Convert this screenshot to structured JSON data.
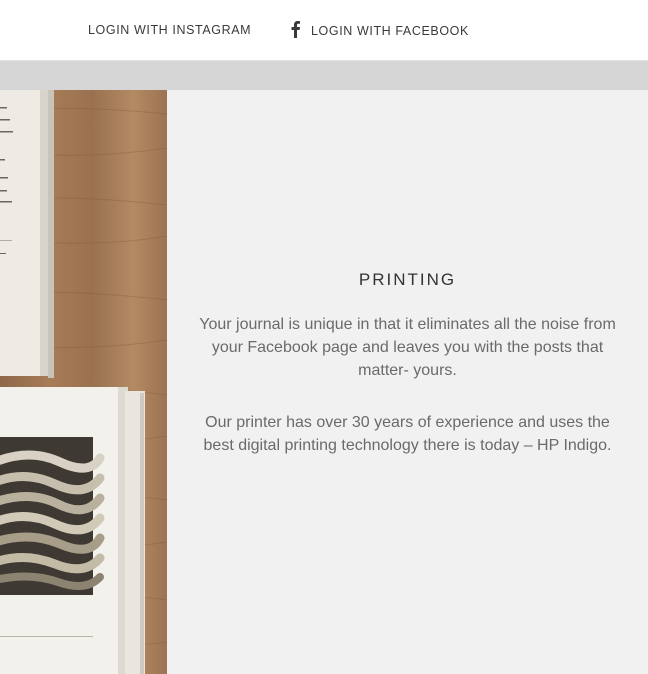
{
  "nav": {
    "instagram_label": "LOGIN WITH INSTAGRAM",
    "facebook_label": "LOGIN WITH FACEBOOK",
    "facebook_icon": "facebook-icon"
  },
  "photo": {
    "description_icon": "open-books-on-wood-image"
  },
  "section": {
    "title": "PRINTING",
    "paragraph1": "Your journal is unique in that it eliminates all the noise from your Facebook page and leaves you with the posts that matter- yours.",
    "paragraph2": "Our printer has over 30 years of experience and uses the best digital printing technology there is today – HP Indigo."
  },
  "colors": {
    "background": "#f1f1f1",
    "topbar": "#ffffff",
    "strip": "#d6d6d6",
    "wood": "#a77c57"
  }
}
